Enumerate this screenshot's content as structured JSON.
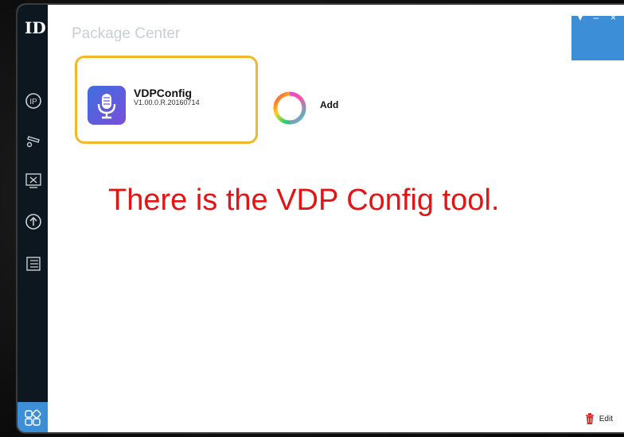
{
  "window": {
    "title": "Package Center"
  },
  "sidebar": {
    "logo": "ID",
    "items": [
      {
        "name": "ip-icon"
      },
      {
        "name": "camera-settings-icon"
      },
      {
        "name": "tools-icon"
      },
      {
        "name": "upgrade-icon"
      },
      {
        "name": "window-icon"
      }
    ],
    "active_item": {
      "name": "package-center-icon"
    }
  },
  "packages": [
    {
      "name": "VDPConfig",
      "version": "V1.00.0.R.20160714",
      "icon": "microphone-icon",
      "highlighted": true
    }
  ],
  "add": {
    "label": "Add",
    "icon": "add-ring-icon"
  },
  "annotation": {
    "text": "There is the VDP Config tool.",
    "color": "#e31414"
  },
  "footer": {
    "edit_label": "Edit",
    "edit_icon": "trash-icon"
  },
  "colors": {
    "accent": "#3c8ed6",
    "sidebar": "#0d1720",
    "highlight": "#f2b82a"
  }
}
